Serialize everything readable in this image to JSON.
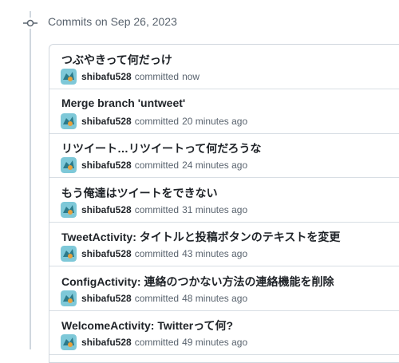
{
  "group": {
    "date_label": "Commits on Sep 26, 2023"
  },
  "commits": [
    {
      "title": "つぶやきって何だっけ",
      "author": "shibafu528",
      "action": "committed",
      "time": "now"
    },
    {
      "title": "Merge branch 'untweet'",
      "author": "shibafu528",
      "action": "committed",
      "time": "20 minutes ago"
    },
    {
      "title": "リツイート…リツイートって何だろうな",
      "author": "shibafu528",
      "action": "committed",
      "time": "24 minutes ago"
    },
    {
      "title": "もう俺達はツイートをできない",
      "author": "shibafu528",
      "action": "committed",
      "time": "31 minutes ago"
    },
    {
      "title": "TweetActivity: タイトルと投稿ボタンのテキストを変更",
      "author": "shibafu528",
      "action": "committed",
      "time": "43 minutes ago"
    },
    {
      "title": "ConfigActivity: 連絡のつかない方法の連絡機能を削除",
      "author": "shibafu528",
      "action": "committed",
      "time": "48 minutes ago"
    },
    {
      "title": "WelcomeActivity: Twitterって何?",
      "author": "shibafu528",
      "action": "committed",
      "time": "49 minutes ago"
    }
  ],
  "colors": {
    "border": "#d0d7de",
    "muted_text": "#59636e",
    "avatar_bg": "#7ec8d8"
  },
  "icons": {
    "timeline_node": "git-commit-icon",
    "avatar": "user-avatar-icon"
  }
}
